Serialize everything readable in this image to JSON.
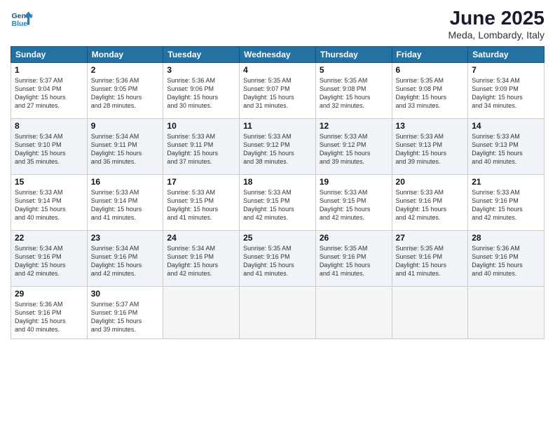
{
  "header": {
    "logo_line1": "General",
    "logo_line2": "Blue",
    "month": "June 2025",
    "location": "Meda, Lombardy, Italy"
  },
  "weekdays": [
    "Sunday",
    "Monday",
    "Tuesday",
    "Wednesday",
    "Thursday",
    "Friday",
    "Saturday"
  ],
  "rows": [
    [
      {
        "day": "1",
        "info": "Sunrise: 5:37 AM\nSunset: 9:04 PM\nDaylight: 15 hours\nand 27 minutes."
      },
      {
        "day": "2",
        "info": "Sunrise: 5:36 AM\nSunset: 9:05 PM\nDaylight: 15 hours\nand 28 minutes."
      },
      {
        "day": "3",
        "info": "Sunrise: 5:36 AM\nSunset: 9:06 PM\nDaylight: 15 hours\nand 30 minutes."
      },
      {
        "day": "4",
        "info": "Sunrise: 5:35 AM\nSunset: 9:07 PM\nDaylight: 15 hours\nand 31 minutes."
      },
      {
        "day": "5",
        "info": "Sunrise: 5:35 AM\nSunset: 9:08 PM\nDaylight: 15 hours\nand 32 minutes."
      },
      {
        "day": "6",
        "info": "Sunrise: 5:35 AM\nSunset: 9:08 PM\nDaylight: 15 hours\nand 33 minutes."
      },
      {
        "day": "7",
        "info": "Sunrise: 5:34 AM\nSunset: 9:09 PM\nDaylight: 15 hours\nand 34 minutes."
      }
    ],
    [
      {
        "day": "8",
        "info": "Sunrise: 5:34 AM\nSunset: 9:10 PM\nDaylight: 15 hours\nand 35 minutes."
      },
      {
        "day": "9",
        "info": "Sunrise: 5:34 AM\nSunset: 9:11 PM\nDaylight: 15 hours\nand 36 minutes."
      },
      {
        "day": "10",
        "info": "Sunrise: 5:33 AM\nSunset: 9:11 PM\nDaylight: 15 hours\nand 37 minutes."
      },
      {
        "day": "11",
        "info": "Sunrise: 5:33 AM\nSunset: 9:12 PM\nDaylight: 15 hours\nand 38 minutes."
      },
      {
        "day": "12",
        "info": "Sunrise: 5:33 AM\nSunset: 9:12 PM\nDaylight: 15 hours\nand 39 minutes."
      },
      {
        "day": "13",
        "info": "Sunrise: 5:33 AM\nSunset: 9:13 PM\nDaylight: 15 hours\nand 39 minutes."
      },
      {
        "day": "14",
        "info": "Sunrise: 5:33 AM\nSunset: 9:13 PM\nDaylight: 15 hours\nand 40 minutes."
      }
    ],
    [
      {
        "day": "15",
        "info": "Sunrise: 5:33 AM\nSunset: 9:14 PM\nDaylight: 15 hours\nand 40 minutes."
      },
      {
        "day": "16",
        "info": "Sunrise: 5:33 AM\nSunset: 9:14 PM\nDaylight: 15 hours\nand 41 minutes."
      },
      {
        "day": "17",
        "info": "Sunrise: 5:33 AM\nSunset: 9:15 PM\nDaylight: 15 hours\nand 41 minutes."
      },
      {
        "day": "18",
        "info": "Sunrise: 5:33 AM\nSunset: 9:15 PM\nDaylight: 15 hours\nand 42 minutes."
      },
      {
        "day": "19",
        "info": "Sunrise: 5:33 AM\nSunset: 9:15 PM\nDaylight: 15 hours\nand 42 minutes."
      },
      {
        "day": "20",
        "info": "Sunrise: 5:33 AM\nSunset: 9:16 PM\nDaylight: 15 hours\nand 42 minutes."
      },
      {
        "day": "21",
        "info": "Sunrise: 5:33 AM\nSunset: 9:16 PM\nDaylight: 15 hours\nand 42 minutes."
      }
    ],
    [
      {
        "day": "22",
        "info": "Sunrise: 5:34 AM\nSunset: 9:16 PM\nDaylight: 15 hours\nand 42 minutes."
      },
      {
        "day": "23",
        "info": "Sunrise: 5:34 AM\nSunset: 9:16 PM\nDaylight: 15 hours\nand 42 minutes."
      },
      {
        "day": "24",
        "info": "Sunrise: 5:34 AM\nSunset: 9:16 PM\nDaylight: 15 hours\nand 42 minutes."
      },
      {
        "day": "25",
        "info": "Sunrise: 5:35 AM\nSunset: 9:16 PM\nDaylight: 15 hours\nand 41 minutes."
      },
      {
        "day": "26",
        "info": "Sunrise: 5:35 AM\nSunset: 9:16 PM\nDaylight: 15 hours\nand 41 minutes."
      },
      {
        "day": "27",
        "info": "Sunrise: 5:35 AM\nSunset: 9:16 PM\nDaylight: 15 hours\nand 41 minutes."
      },
      {
        "day": "28",
        "info": "Sunrise: 5:36 AM\nSunset: 9:16 PM\nDaylight: 15 hours\nand 40 minutes."
      }
    ],
    [
      {
        "day": "29",
        "info": "Sunrise: 5:36 AM\nSunset: 9:16 PM\nDaylight: 15 hours\nand 40 minutes."
      },
      {
        "day": "30",
        "info": "Sunrise: 5:37 AM\nSunset: 9:16 PM\nDaylight: 15 hours\nand 39 minutes."
      },
      {
        "day": "",
        "info": ""
      },
      {
        "day": "",
        "info": ""
      },
      {
        "day": "",
        "info": ""
      },
      {
        "day": "",
        "info": ""
      },
      {
        "day": "",
        "info": ""
      }
    ]
  ]
}
